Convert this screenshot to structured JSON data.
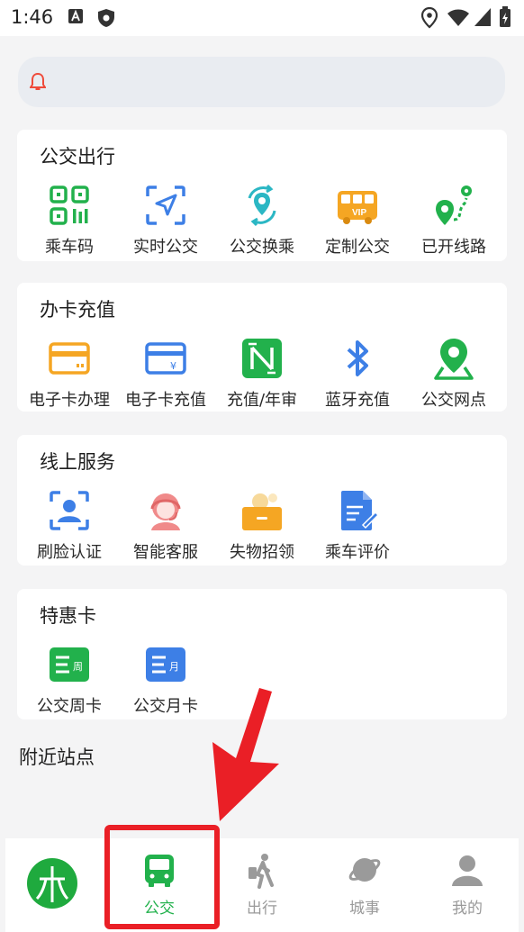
{
  "status_bar": {
    "time": "1:46"
  },
  "notice": {
    "icon": "bell-icon"
  },
  "sections": [
    {
      "title": "公交出行",
      "items": [
        {
          "label": "乘车码",
          "icon": "qr-code-icon"
        },
        {
          "label": "实时公交",
          "icon": "navigation-arrow-icon"
        },
        {
          "label": "公交换乘",
          "icon": "transfer-location-icon"
        },
        {
          "label": "定制公交",
          "icon": "vip-bus-icon"
        },
        {
          "label": "已开线路",
          "icon": "route-pin-icon"
        }
      ]
    },
    {
      "title": "办卡充值",
      "items": [
        {
          "label": "电子卡办理",
          "icon": "card-icon"
        },
        {
          "label": "电子卡充值",
          "icon": "card-yuan-icon"
        },
        {
          "label": "充值/年审",
          "icon": "nfc-icon"
        },
        {
          "label": "蓝牙充值",
          "icon": "bluetooth-icon"
        },
        {
          "label": "公交网点",
          "icon": "map-pin-icon"
        }
      ]
    },
    {
      "title": "线上服务",
      "items": [
        {
          "label": "刷脸认证",
          "icon": "face-scan-icon"
        },
        {
          "label": "智能客服",
          "icon": "customer-service-icon"
        },
        {
          "label": "失物招领",
          "icon": "lost-found-box-icon"
        },
        {
          "label": "乘车评价",
          "icon": "review-document-icon"
        }
      ]
    },
    {
      "title": "特惠卡",
      "items": [
        {
          "label": "公交周卡",
          "icon": "weekly-card-icon",
          "badge": "周"
        },
        {
          "label": "公交月卡",
          "icon": "monthly-card-icon",
          "badge": "月"
        }
      ]
    }
  ],
  "nearby": {
    "title": "附近站点"
  },
  "tabbar": {
    "items": [
      {
        "label": "",
        "icon": "app-logo-icon"
      },
      {
        "label": "公交",
        "icon": "bus-icon",
        "active": true
      },
      {
        "label": "出行",
        "icon": "walking-traveler-icon"
      },
      {
        "label": "城事",
        "icon": "planet-icon"
      },
      {
        "label": "我的",
        "icon": "person-icon"
      }
    ]
  },
  "colors": {
    "accent_green": "#22b14c",
    "highlight_red": "#ea1f26",
    "icon_blue": "#3d7fe6",
    "icon_orange": "#f5a623"
  }
}
